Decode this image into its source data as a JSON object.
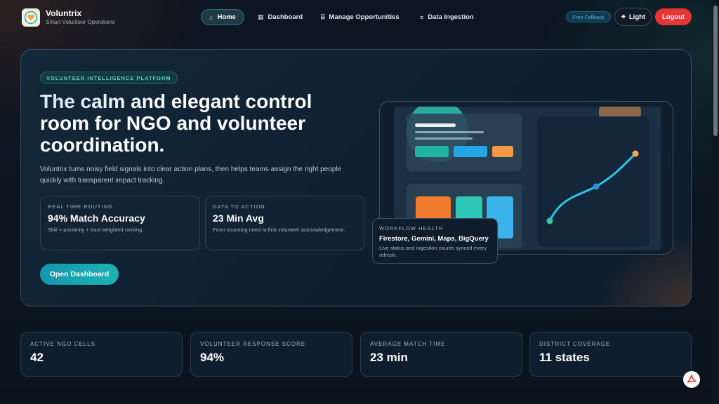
{
  "brand": {
    "name": "Voluntrix",
    "tagline": "Smart Volunteer Operations"
  },
  "nav": [
    {
      "label": "Home",
      "icon": "home-icon",
      "active": true
    },
    {
      "label": "Dashboard",
      "icon": "dashboard-icon",
      "active": false
    },
    {
      "label": "Manage Opportunities",
      "icon": "bank-icon",
      "active": false
    },
    {
      "label": "Data Ingestion",
      "icon": "document-icon",
      "active": false
    }
  ],
  "header": {
    "fallback_badge": "Free Fallback",
    "theme_label": "Light",
    "logout_label": "Logout"
  },
  "hero": {
    "eyebrow": "VOLUNTEER INTELLIGENCE PLATFORM",
    "headline_line1": "The calm and elegant control",
    "headline_line2": "room for NGO and volunteer",
    "headline_line3": "coordination.",
    "lede": "Voluntrix turns noisy field signals into clear action plans, then helps teams assign the right people quickly with transparent impact tracking.",
    "cards": [
      {
        "label": "REAL TIME ROUTING",
        "value": "94% Match Accuracy",
        "desc": "Skill + proximity + trust weighted ranking."
      },
      {
        "label": "DATA TO ACTION",
        "value": "23 Min Avg",
        "desc": "From incoming need to first volunteer acknowledgement."
      }
    ],
    "cta": "Open Dashboard",
    "workflow": {
      "label": "WORKFLOW HEALTH",
      "title": "Firestore, Gemini, Maps, BigQuery",
      "desc": "Live status and ingestion counts synced every refresh."
    }
  },
  "kpis": [
    {
      "label": "ACTIVE NGO CELLS",
      "value": "42"
    },
    {
      "label": "VOLUNTEER RESPONSE SCORE",
      "value": "94%"
    },
    {
      "label": "AVERAGE MATCH TIME",
      "value": "23 min"
    },
    {
      "label": "DISTRICT COVERAGE",
      "value": "11 states"
    }
  ],
  "colors": {
    "accent": "#1fb3b4",
    "logout": "#e53535",
    "chart_line": "#2ec6e8"
  }
}
